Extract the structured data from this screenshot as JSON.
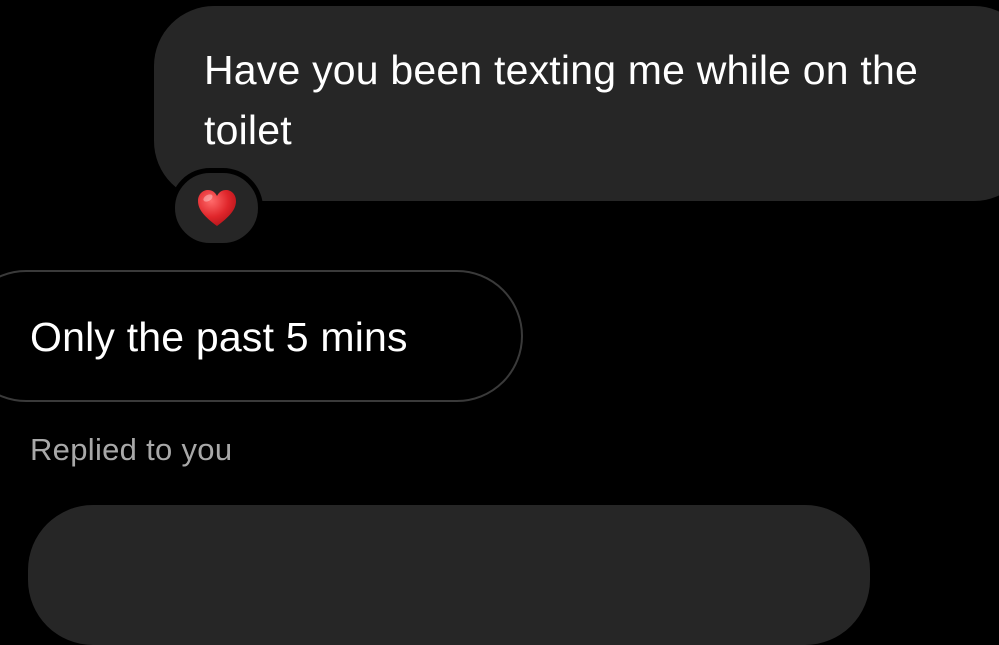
{
  "conversation": {
    "message_top": {
      "text": "Have you been texting me while on the toilet",
      "reaction_icon": "red-heart-icon",
      "reaction_color": "#e0262b"
    },
    "message_reply": {
      "text": "Only the past 5 mins",
      "status": "Replied to you"
    },
    "message_bottom": {
      "text": ""
    }
  },
  "colors": {
    "background": "#000000",
    "bubble": "#262626",
    "outline": "#3a3a3a",
    "secondary_text": "#a8a8a8"
  }
}
